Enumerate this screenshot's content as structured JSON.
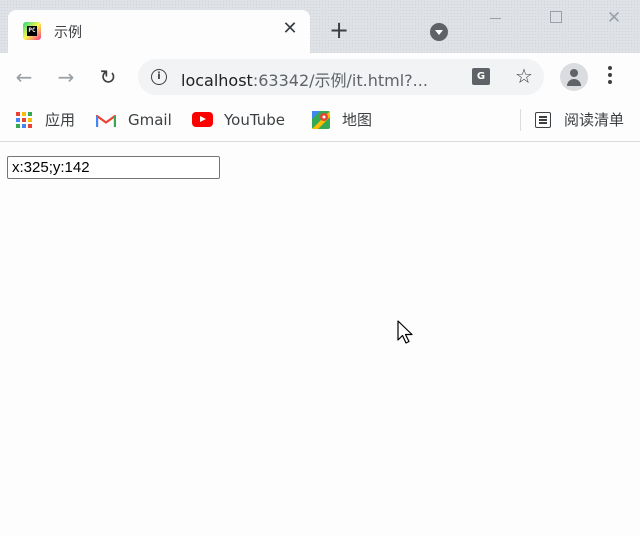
{
  "tab": {
    "title": "示例",
    "close_glyph": "✕"
  },
  "window_controls": {
    "close_glyph": "✕"
  },
  "toolbar": {
    "url_host": "localhost",
    "url_rest": ":63342/示例/it.html?...",
    "translate_text": "G",
    "back_glyph": "←",
    "forward_glyph": "→",
    "reload_glyph": "↻",
    "star_glyph": "☆",
    "newtab_glyph": "+"
  },
  "bookmarks": {
    "items": [
      {
        "label": "应用",
        "icon": "apps-grid-icon"
      },
      {
        "label": "Gmail",
        "icon": "gmail-icon"
      },
      {
        "label": "YouTube",
        "icon": "youtube-icon"
      },
      {
        "label": "地图",
        "icon": "maps-icon"
      }
    ],
    "reading_list": "阅读清单"
  },
  "page": {
    "coord_value": "x:325;y:142"
  },
  "colors": {
    "tab_strip": "#dee1e6",
    "omnibox": "#f1f3f4",
    "youtube_red": "#ff0000"
  }
}
